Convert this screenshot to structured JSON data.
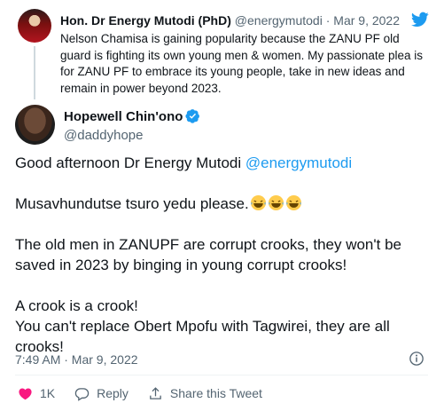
{
  "parent_tweet": {
    "author_name": "Hon. Dr Energy Mutodi (PhD)",
    "handle": "@energymutodi",
    "separator": " · ",
    "date": "Mar 9, 2022",
    "text": "Nelson Chamisa is gaining popularity because the ZANU PF old guard is fighting its own young men & women. My passionate plea is for ZANU PF to embrace its young people, take in new ideas and remain in power beyond 2023."
  },
  "tweet": {
    "author_name": "Hopewell Chin'ono",
    "handle": "@daddyhope",
    "greeting": "Good afternoon Dr Energy Mutodi ",
    "mention": "@energymutodi",
    "line2": "Musavhundutse tsuro yedu please.",
    "line3": "The old men in ZANUPF are corrupt crooks, they won't be saved in 2023 by binging in young corrupt crooks!",
    "line4a": "A crook is a crook!",
    "line4b": "You can't replace Obert Mpofu with Tagwirei, they are all crooks!",
    "timestamp": "7:49 AM · Mar 9, 2022"
  },
  "actions": {
    "like_count": "1K",
    "reply_label": "Reply",
    "share_label": "Share this Tweet"
  },
  "colors": {
    "accent": "#1d9bf0",
    "secondary_text": "#536471",
    "like_red": "#f91880"
  },
  "icons": [
    "twitter-bird-icon",
    "verified-badge-icon",
    "laughing-emoji-icon",
    "info-icon",
    "heart-icon",
    "reply-icon",
    "share-icon"
  ]
}
